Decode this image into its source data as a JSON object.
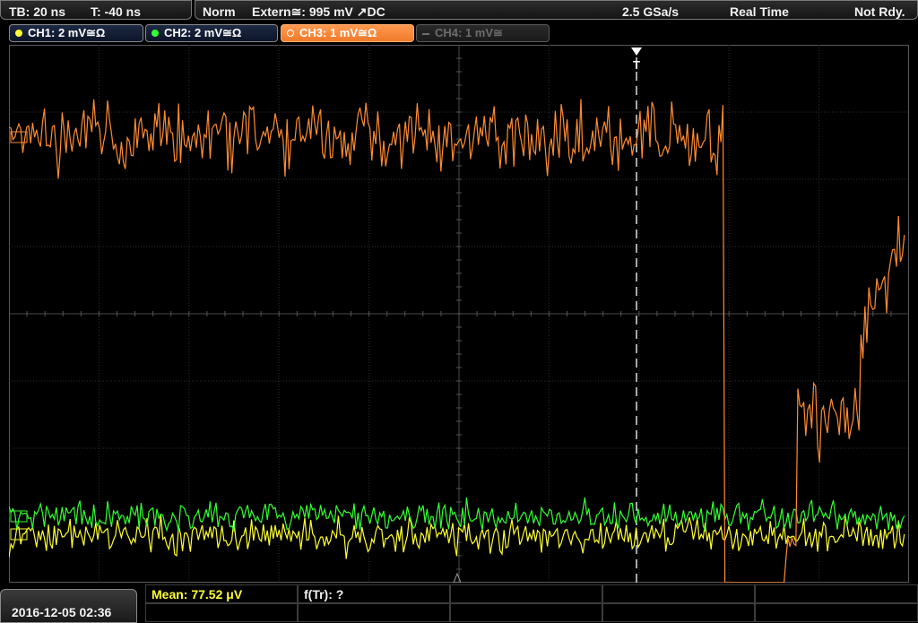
{
  "topbar": {
    "timebase": "TB: 20 ns",
    "trigger_time": "T: -40 ns",
    "acq_mode": "Norm",
    "trigger_source": "Extern≅: 995 mV ↗DC",
    "sample_rate": "2.5 GSa/s",
    "acq_type": "Real Time",
    "status": "Not Rdy."
  },
  "channels": [
    {
      "label": "CH1: 2 mV≅Ω",
      "color": "#ffff33",
      "active": true
    },
    {
      "label": "CH2: 2 mV≅Ω",
      "color": "#33ff33",
      "active": true
    },
    {
      "label": "CH3: 1 mV≅Ω",
      "color": "#ff8c33",
      "active": true
    },
    {
      "label": "CH4: 1 mV≅",
      "color": "#6c6c6c",
      "active": false
    }
  ],
  "trigger_marker": "T",
  "footer": {
    "datetime": "2016-12-05 02:36",
    "measurement_mean": "Mean: 77.52 μV",
    "measurement_freq": "f(Tr): ?"
  },
  "colors": {
    "ch1": "#ffff33",
    "ch2": "#33ff33",
    "ch3": "#ff8c33",
    "grid": "#3a3a3a"
  }
}
